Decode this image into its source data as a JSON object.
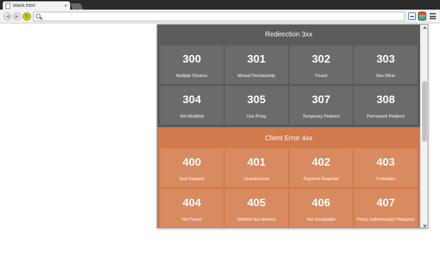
{
  "browser": {
    "tab_title": "blank.html",
    "tab_close": "×",
    "address_value": "",
    "back_glyph": "◀",
    "forward_glyph": "▶",
    "reload_glyph": "↻"
  },
  "popup": {
    "redirection": {
      "title": "Redirection 3xx",
      "color": "#5b5b5b",
      "card_color": "#6b6b6b",
      "codes": [
        {
          "code": "300",
          "label": "Multiple Choices"
        },
        {
          "code": "301",
          "label": "Moved Permanently"
        },
        {
          "code": "302",
          "label": "Found"
        },
        {
          "code": "303",
          "label": "See Other"
        },
        {
          "code": "304",
          "label": "Not Modified"
        },
        {
          "code": "305",
          "label": "Use Proxy"
        },
        {
          "code": "307",
          "label": "Temporary Redirect"
        },
        {
          "code": "308",
          "label": "Permanent Redirect"
        }
      ]
    },
    "client_error": {
      "title": "Client Error 4xx",
      "color": "#d07a4e",
      "card_color": "#d88a60",
      "codes": [
        {
          "code": "400",
          "label": "Bad Request"
        },
        {
          "code": "401",
          "label": "Unauthorized"
        },
        {
          "code": "402",
          "label": "Payment Required"
        },
        {
          "code": "403",
          "label": "Forbidden"
        },
        {
          "code": "404",
          "label": "Not Found"
        },
        {
          "code": "405",
          "label": "Method Not Allowed"
        },
        {
          "code": "406",
          "label": "Not Acceptable"
        },
        {
          "code": "407",
          "label": "Proxy Authentication Required"
        }
      ]
    }
  }
}
